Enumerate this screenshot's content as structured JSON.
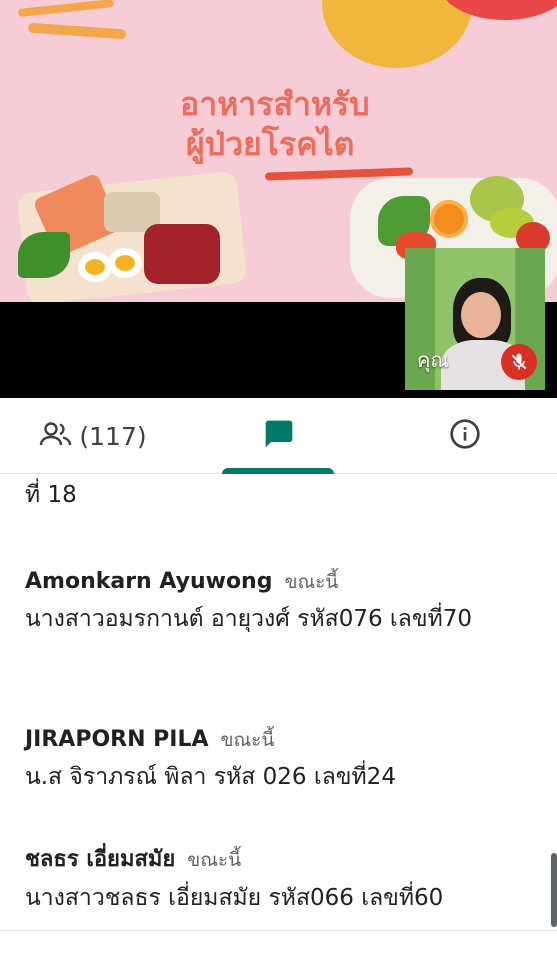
{
  "slide": {
    "title_line1": "อาหารสำหรับ",
    "title_line2": "ผู้ป่วยโรคไต"
  },
  "self_view": {
    "name": "คุณ",
    "mic_state": "muted",
    "mic_icon": "mic-off-icon",
    "mic_color": "#d93025"
  },
  "tabs": {
    "people": {
      "icon": "people-icon",
      "count_label": "(117)"
    },
    "chat": {
      "icon": "chat-icon",
      "selected": true,
      "accent": "#00796b"
    },
    "info": {
      "icon": "info-icon"
    }
  },
  "chat": {
    "partial_previous": {
      "text_tail": "ที่ 18"
    },
    "messages": [
      {
        "sender": "Amonkarn Ayuwong",
        "time": "ขณะนี้",
        "text": "นางสาวอมรกานต์ อายุวงศ์ รหัส076 เลขที่70"
      },
      {
        "sender": "JIRAPORN PILA",
        "time": "ขณะนี้",
        "text": "น.ส จิราภรณ์ พิลา รหัส 026 เลขที่24"
      },
      {
        "sender": "ชลธร เอี่ยมสมัย",
        "time": "ขณะนี้",
        "text": "นางสาวชลธร เอี่ยมสมัย รหัส066 เลขที่60"
      }
    ]
  }
}
